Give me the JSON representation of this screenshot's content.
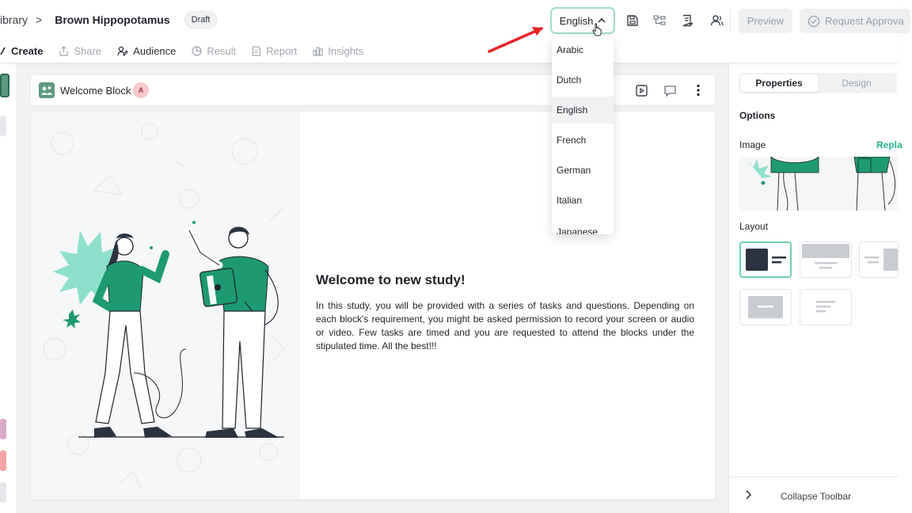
{
  "header": {
    "breadcrumb_library": "ibrary",
    "breadcrumb_separator": ">",
    "study_title": "Brown Hippopotamus",
    "status_badge": "Draft",
    "language_selected": "English",
    "preview_label": "Preview",
    "request_approval_label": "Request Approva"
  },
  "tabs": [
    {
      "label": "Create",
      "icon": "edit-icon",
      "state": "active"
    },
    {
      "label": "Share",
      "icon": "share-icon",
      "state": "disabled"
    },
    {
      "label": "Audience",
      "icon": "audience-icon",
      "state": "normal"
    },
    {
      "label": "Result",
      "icon": "result-icon",
      "state": "disabled"
    },
    {
      "label": "Report",
      "icon": "report-icon",
      "state": "disabled"
    },
    {
      "label": "Insights",
      "icon": "insights-icon",
      "state": "disabled"
    }
  ],
  "language_dropdown": {
    "options": [
      "Arabic",
      "Dutch",
      "English",
      "French",
      "German",
      "Italian",
      "Japanese"
    ],
    "selected": "English"
  },
  "block": {
    "title": "Welcome Block",
    "avatar_initial": "A",
    "heading": "Welcome to new study!",
    "body": "In this study, you will be provided with a series of tasks and questions. Depending on each block's requirement, you might be asked permission to record your screen or audio or video. Few tasks are timed and you are requested to attend the blocks under the stipulated time. All the best!!!"
  },
  "right_panel": {
    "tabs": [
      "Properties",
      "Design"
    ],
    "active_tab": "Properties",
    "options_label": "Options",
    "image_label": "Image",
    "replace_label": "Repla",
    "layout_label": "Layout",
    "collapse_label": "Collapse Toolbar"
  },
  "colors": {
    "accent": "#25b58e",
    "illustration_green": "#1e9a72",
    "annotation_arrow": "#e5252a"
  }
}
